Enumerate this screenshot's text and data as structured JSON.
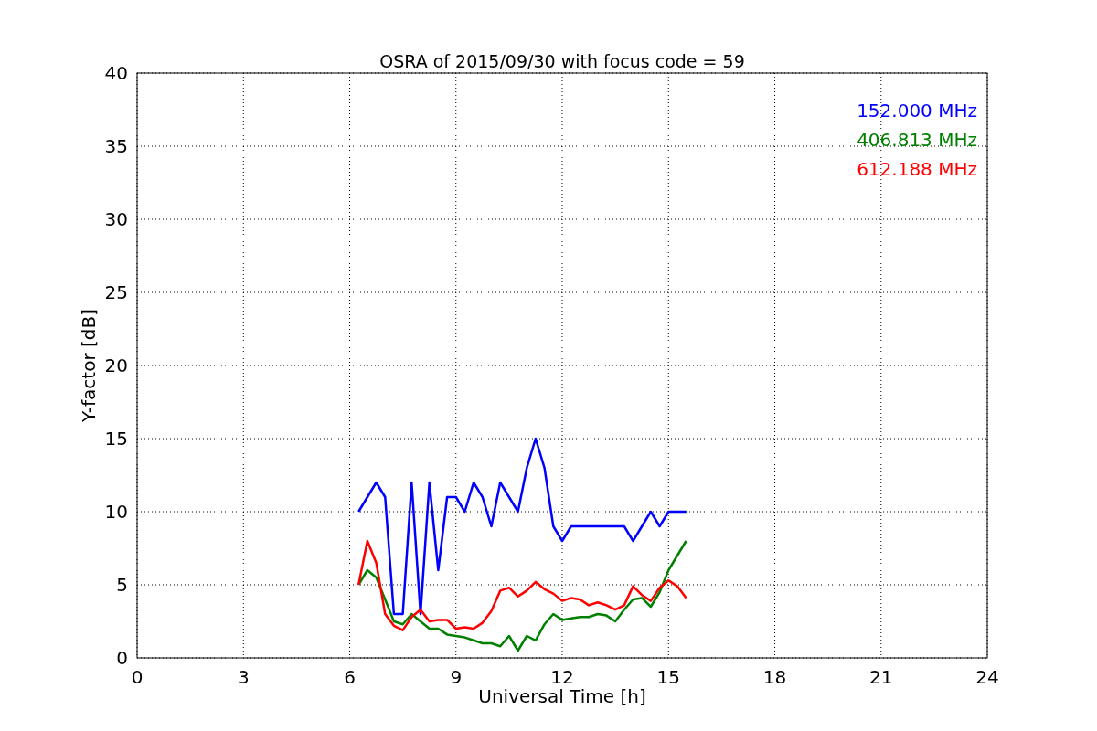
{
  "figure": {
    "chart_data": {
      "type": "line",
      "title": "OSRA of 2015/09/30 with focus code = 59",
      "xlabel": "Universal Time [h]",
      "ylabel": "Y-factor [dB]",
      "x": [
        6.25,
        6.5,
        6.75,
        7,
        7.25,
        7.5,
        7.75,
        8,
        8.25,
        8.5,
        8.75,
        9,
        9.25,
        9.5,
        9.75,
        10,
        10.25,
        10.5,
        10.75,
        11,
        11.25,
        11.5,
        11.75,
        12,
        12.25,
        12.5,
        12.75,
        13,
        13.25,
        13.5,
        13.75,
        14,
        14.25,
        14.5,
        14.75,
        15,
        15.25,
        15.5
      ],
      "series": [
        {
          "name": "152.000 MHz",
          "color": "#0000ff",
          "values": [
            10,
            11,
            12,
            11,
            3,
            3,
            12,
            3,
            12,
            6,
            11,
            11,
            10,
            12,
            11,
            9,
            12,
            11,
            10,
            13,
            15,
            13,
            9,
            8,
            9,
            9,
            9,
            9,
            9,
            9,
            9,
            8,
            9,
            10,
            9,
            10,
            10,
            10
          ]
        },
        {
          "name": "406.813 MHz",
          "color": "#008000",
          "values": [
            5,
            6,
            5.5,
            4,
            2.5,
            2.3,
            3,
            2.5,
            2,
            2,
            1.6,
            1.5,
            1.4,
            1.2,
            1,
            1,
            0.8,
            1.5,
            0.5,
            1.5,
            1.2,
            2.3,
            3,
            2.6,
            2.7,
            2.8,
            2.8,
            3,
            2.9,
            2.5,
            3.3,
            4,
            4.1,
            3.5,
            4.5,
            6,
            7,
            8
          ]
        },
        {
          "name": "612.188 MHz",
          "color": "#ff0000",
          "values": [
            5,
            8,
            6.5,
            3,
            2.2,
            1.9,
            2.8,
            3.3,
            2.5,
            2.6,
            2.6,
            2,
            2.1,
            2,
            2.4,
            3.2,
            4.6,
            4.8,
            4.2,
            4.6,
            5.2,
            4.7,
            4.4,
            3.9,
            4.1,
            4,
            3.6,
            3.8,
            3.6,
            3.3,
            3.6,
            4.9,
            4.3,
            3.9,
            4.8,
            5.3,
            4.9,
            4.1
          ]
        }
      ],
      "grid": true,
      "xlim": [
        0,
        24
      ],
      "ylim": [
        0,
        40
      ],
      "xticks": [
        0,
        3,
        6,
        9,
        12,
        15,
        18,
        21,
        24
      ],
      "yticks": [
        0,
        5,
        10,
        15,
        20,
        25,
        30,
        35,
        40
      ]
    }
  }
}
